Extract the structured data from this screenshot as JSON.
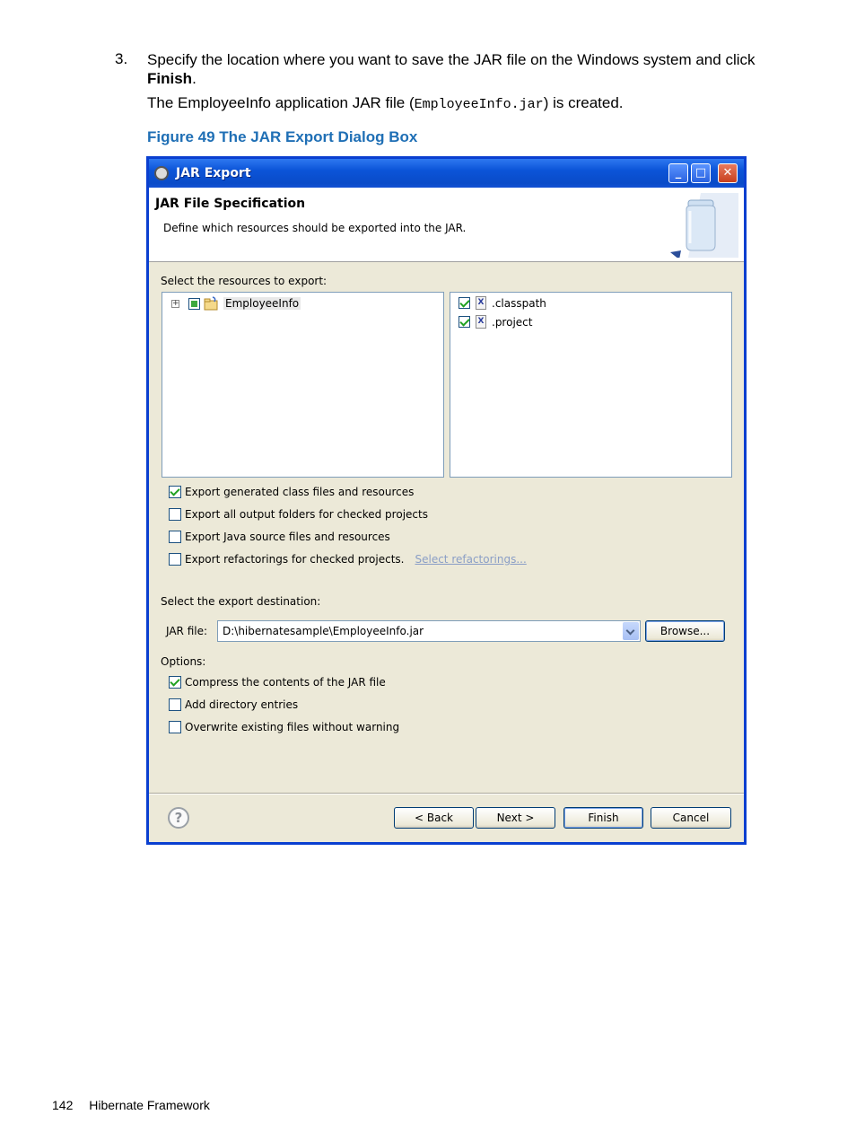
{
  "doc": {
    "step_number": "3.",
    "step_text": "Specify the location where you want to save the JAR file on the Windows system and click",
    "step_bold": "Finish",
    "step_tail": ".",
    "result_prefix": "The EmployeeInfo application JAR file (",
    "result_code": "EmployeeInfo.jar",
    "result_suffix": ") is created.",
    "figure_caption": "Figure 49 The JAR Export Dialog Box",
    "footer_page": "142",
    "footer_title": "Hibernate Framework"
  },
  "dialog": {
    "title": "JAR Export",
    "banner_title": "JAR File Specification",
    "banner_desc": "Define which resources should be exported into the JAR.",
    "resources_label": "Select the resources to export:",
    "tree": {
      "project": "EmployeeInfo",
      "expander": "+"
    },
    "files": [
      {
        "name": ".classpath",
        "checked": true
      },
      {
        "name": ".project",
        "checked": true
      }
    ],
    "export_options": [
      {
        "label": "Export generated class files and resources",
        "checked": true
      },
      {
        "label": "Export all output folders for checked projects",
        "checked": false
      },
      {
        "label": "Export Java source files and resources",
        "checked": false
      },
      {
        "label": "Export refactorings for checked projects.",
        "checked": false
      }
    ],
    "refactor_link": "Select refactorings...",
    "destination_label": "Select the export destination:",
    "jar_label": "JAR file:",
    "jar_value": "D:\\hibernatesample\\EmployeeInfo.jar",
    "browse": "Browse...",
    "options_label": "Options:",
    "options": [
      {
        "label": "Compress the contents of the JAR file",
        "checked": true
      },
      {
        "label": "Add directory entries",
        "checked": false
      },
      {
        "label": "Overwrite existing files without warning",
        "checked": false
      }
    ],
    "help": "?",
    "buttons": {
      "back": "< Back",
      "next": "Next >",
      "finish": "Finish",
      "cancel": "Cancel"
    },
    "titlebar_buttons": {
      "minimize": "_",
      "maximize": "□",
      "close": "✕"
    }
  }
}
